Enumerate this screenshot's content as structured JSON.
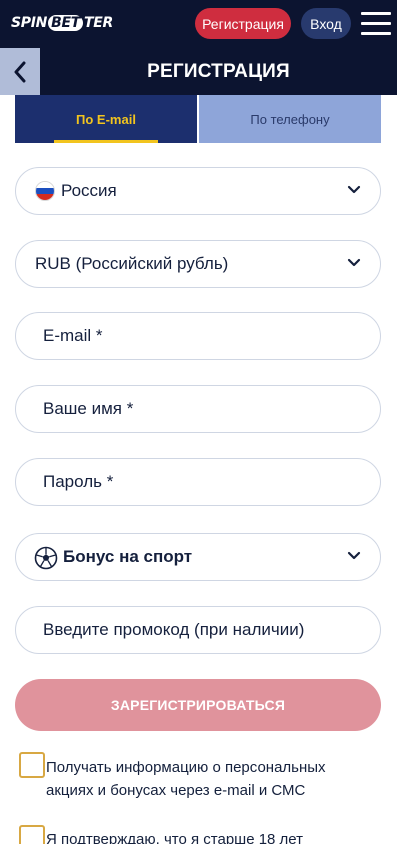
{
  "header": {
    "logo": {
      "spin": "SPIN",
      "bet": "BET",
      "ter": "TER"
    },
    "register_label": "Регистрация",
    "login_label": "Вход"
  },
  "titlebar": {
    "title": "РЕГИСТРАЦИЯ"
  },
  "tabs": [
    {
      "label": "По E-mail",
      "active": true
    },
    {
      "label": "По телефону",
      "active": false
    }
  ],
  "form": {
    "country": "Россия",
    "currency": "RUB (Российский рубль)",
    "email_placeholder": "E-mail *",
    "name_placeholder": "Ваше имя *",
    "password_placeholder": "Пароль *",
    "bonus": "Бонус на спорт",
    "promo_placeholder": "Введите промокод (при наличии)"
  },
  "submit_label": "ЗАРЕГИСТРИРОВАТЬСЯ",
  "checkboxes": [
    {
      "label": "Получать информацию о персональных акциях и бонусах через e-mail и СМС",
      "checked": false
    },
    {
      "label": "Я подтверждаю, что я старше 18 лет",
      "checked": false
    }
  ],
  "colors": {
    "header_bg": "#0c1430",
    "register_red": "#cf2d3f",
    "active_tab_bg": "#1c2f6e",
    "active_tab_text": "#f2c41e",
    "inactive_tab_bg": "#8ea5d9",
    "submit_disabled": "#e0939c",
    "checkbox_border": "#d8a843"
  },
  "icons": [
    "back-arrow-icon",
    "menu-icon",
    "russia-flag-icon",
    "chevron-down-icon",
    "soccer-ball-icon"
  ]
}
